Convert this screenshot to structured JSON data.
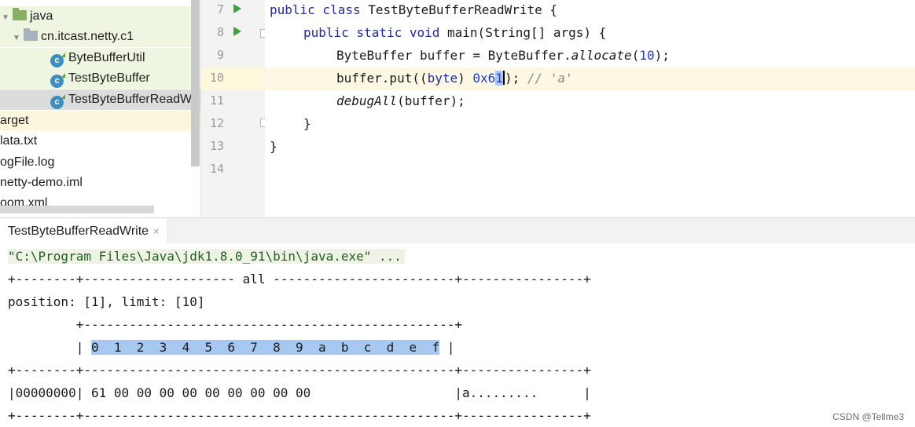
{
  "project_tree": {
    "items": [
      {
        "label": "java"
      },
      {
        "label": "cn.itcast.netty.c1"
      },
      {
        "label": "ByteBufferUtil"
      },
      {
        "label": "TestByteBuffer"
      },
      {
        "label": "TestByteBufferReadW"
      },
      {
        "label": "arget"
      },
      {
        "label": "lata.txt"
      },
      {
        "label": "ogFile.log"
      },
      {
        "label": "netty-demo.iml"
      },
      {
        "label": "oom.xml"
      }
    ],
    "class_icon_letter": "c"
  },
  "editor": {
    "line_numbers": [
      "7",
      "8",
      "9",
      "10",
      "11",
      "12",
      "13",
      "14"
    ],
    "line7": {
      "kw": "public class",
      "rest": " TestByteBufferReadWrite {"
    },
    "line8": {
      "kw": "public static void",
      "rest1": " main(String[] args) {"
    },
    "line9": {
      "t1": "ByteBuffer buffer = ByteBuffer.",
      "it": "allocate",
      "t2": "(",
      "num": "10",
      "t3": ");"
    },
    "line10": {
      "t1": "buffer.put((",
      "kw": "byte",
      "t2": ") ",
      "num_a": "0x6",
      "num_b": "1",
      "t3": "); ",
      "cmt": "// 'a'"
    },
    "line11": {
      "it": "debugAll",
      "t1": "(buffer);"
    },
    "line12": {
      "t1": "}"
    },
    "line13": {
      "t1": "}"
    }
  },
  "run_panel": {
    "tab_label": "TestByteBufferReadWrite",
    "close_glyph": "×",
    "console": {
      "cmd": "\"C:\\Program Files\\Java\\jdk1.8.0_91\\bin\\java.exe\" ...",
      "line_all": "+--------+-------------------- all ------------------------+----------------+",
      "line_pos": "position: [1], limit: [10]",
      "line_top": "         +-------------------------------------------------+",
      "hdr_left": "         | ",
      "hdr_cols": "0  1  2  3  4  5  6  7  8  9  a  b  c  d  e  f",
      "hdr_right": " |",
      "line_sep": "+--------+-------------------------------------------------+----------------+",
      "data_row": "|00000000| 61 00 00 00 00 00 00 00 00 00                   |a.........      |",
      "line_bottom": "+--------+-------------------------------------------------+----------------+"
    }
  },
  "watermark": "CSDN @Tellme3",
  "colors": {
    "keyword": "#1f2aa6",
    "number": "#1f39d6",
    "comment": "#8a8a8a",
    "selection": "#a6c8f1"
  }
}
